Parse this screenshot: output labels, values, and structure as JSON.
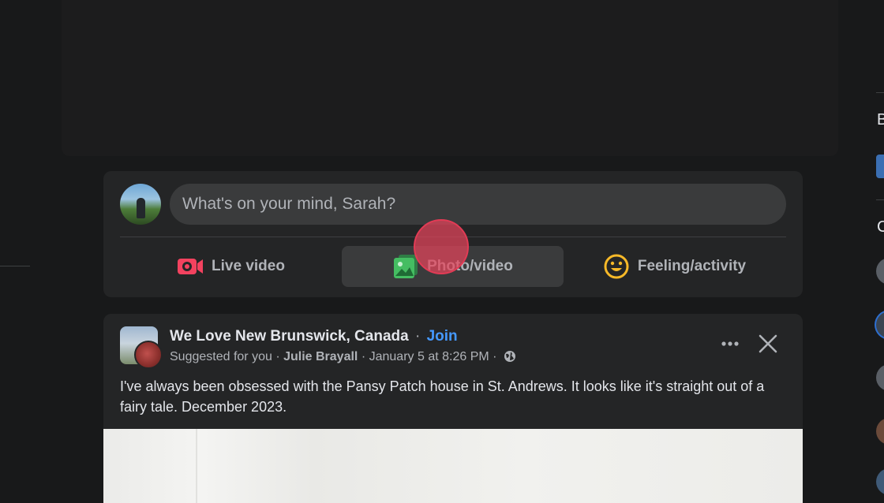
{
  "composer": {
    "placeholder": "What's on your mind, Sarah?",
    "actions": [
      {
        "label": "Live video",
        "icon": "live-video-icon",
        "color": "#f3425f"
      },
      {
        "label": "Photo/video",
        "icon": "photo-video-icon",
        "color": "#45bd62"
      },
      {
        "label": "Feeling/activity",
        "icon": "feeling-activity-icon",
        "color": "#f7b928"
      }
    ]
  },
  "post": {
    "group_name": "We Love New Brunswick, Canada",
    "separator": "·",
    "join_label": "Join",
    "meta_prefix": "Suggested for you ·",
    "author": "Julie Brayall",
    "date": "· January 5 at 8:26 PM ·",
    "audience_icon": "globe-icon",
    "text": "I've always been obsessed with the Pansy Patch house in St. Andrews. It looks like it's straight out of a fairy tale. December 2023."
  },
  "right_sidebar": {
    "section_letters": [
      "B",
      "C"
    ]
  },
  "colors": {
    "background": "#18191a",
    "card": "#242526",
    "link": "#4599ff"
  }
}
